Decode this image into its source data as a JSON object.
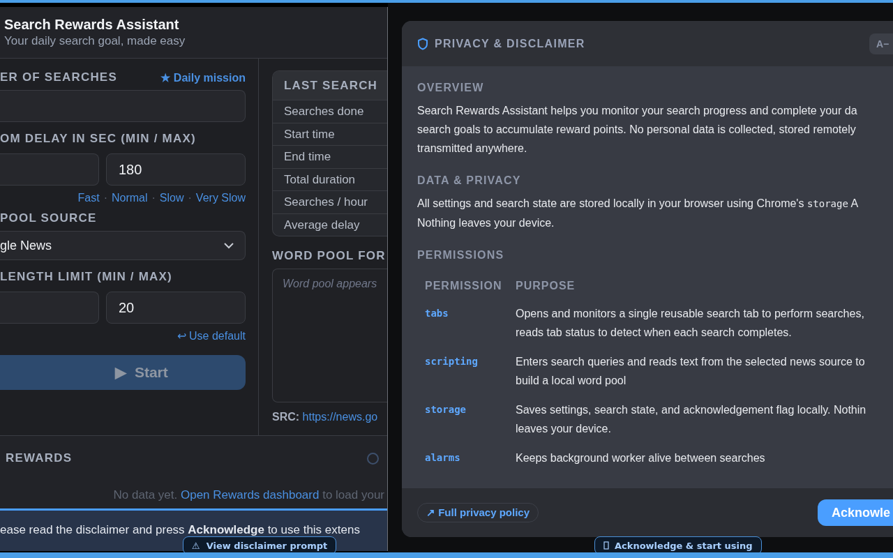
{
  "app": {
    "header": {
      "title": "Search Rewards Assistant",
      "subtitle": "Your daily search goal, made easy"
    },
    "searches": {
      "label": "ER OF SEARCHES",
      "mission_icon": "★",
      "mission_link": "Daily mission"
    },
    "delay": {
      "label": "OM DELAY IN SEC (MIN / MAX)",
      "max_value": "180",
      "presets": [
        "Fast",
        "Normal",
        "Slow",
        "Very Slow"
      ],
      "separator": "·"
    },
    "pool_source": {
      "label": "POOL SOURCE",
      "value": "gle News"
    },
    "length_limit": {
      "label": "LENGTH LIMIT (MIN / MAX)",
      "max_value": "20",
      "reset_icon": "↩",
      "reset_link": "Use default"
    },
    "start_button": {
      "icon": "▶",
      "label": "Start",
      "disabled": true
    },
    "stats": {
      "title": "LAST SEARCH",
      "rows": [
        "Searches done",
        "Start time",
        "End time",
        "Total duration",
        "Searches / hour",
        "Average delay"
      ]
    },
    "word_pool": {
      "label": "WORD POOL FOR",
      "placeholder": "Word pool appears",
      "src_label": "SRC:",
      "src_url": "https://news.go"
    },
    "rewards": {
      "title": "REWARDS",
      "message": "No data yet.",
      "link": "Open Rewards dashboard",
      "message_end": "to load your"
    },
    "banner": {
      "text": "ease read the disclaimer and press **Acknowledge** to use this extens"
    },
    "badge": {
      "icon": "⚠",
      "label": "View disclaimer prompt"
    }
  },
  "modal": {
    "title": "PRIVACY & DISCLAIMER",
    "font_button": "A−",
    "sections": [
      {
        "heading": "OVERVIEW",
        "lines": [
          {
            "text": "Search Rewards Assistant helps you monitor your search progress and complete your da"
          },
          {
            "text": "search goals to accumulate reward points. No personal data is collected, stored remotely"
          },
          {
            "text": "transmitted anywhere."
          }
        ]
      },
      {
        "heading": "DATA & PRIVACY",
        "lines": [
          {
            "text": "All settings and search state are stored locally in your browser using Chrome's ",
            "code": "storage",
            "after": " A"
          },
          {
            "text": "Nothing leaves your device."
          }
        ]
      }
    ],
    "permissions": {
      "heading": "PERMISSIONS",
      "columns": [
        "PERMISSION",
        "PURPOSE"
      ],
      "rows": [
        {
          "permission": "tabs",
          "purpose": [
            "Opens and monitors a single reusable search tab to perform searches,",
            "reads tab status to detect when each search completes."
          ]
        },
        {
          "permission": "scripting",
          "purpose": [
            "Enters search queries and reads text from the selected news source to",
            "build a local word pool"
          ]
        },
        {
          "permission": "storage",
          "purpose": [
            "Saves settings, search state, and acknowledgement flag locally. Nothin",
            "leaves your device."
          ]
        },
        {
          "permission": "alarms",
          "purpose": [
            "Keeps background worker alive between searches"
          ]
        }
      ]
    },
    "policy_link": {
      "icon": "↗",
      "label": "Full privacy policy"
    },
    "acknowledge_button": "Acknowle",
    "badge": {
      "label": "Acknowledge & start using"
    }
  }
}
